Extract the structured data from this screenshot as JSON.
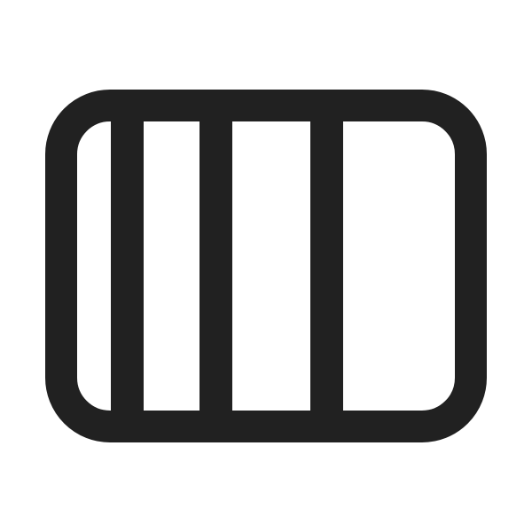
{
  "icon": {
    "name": "board-columns-icon",
    "stroke_color": "#212121",
    "background_color": "#ffffff"
  }
}
